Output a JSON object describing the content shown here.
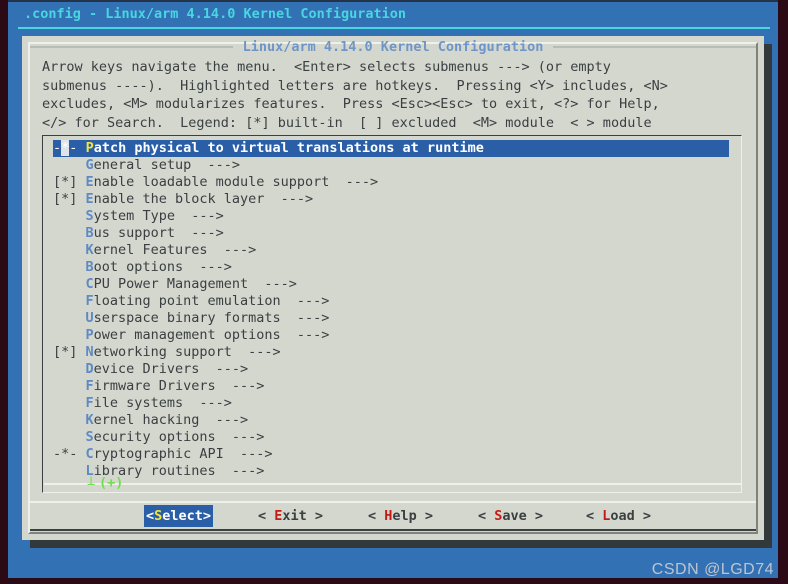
{
  "window": {
    "title": ".config - Linux/arm 4.14.0 Kernel Configuration"
  },
  "dialog": {
    "title": "Linux/arm 4.14.0 Kernel Configuration",
    "help_lines": [
      "Arrow keys navigate the menu.  <Enter> selects submenus ---> (or empty",
      "submenus ----).  Highlighted letters are hotkeys.  Pressing <Y> includes, <N>",
      "excludes, <M> modularizes features.  Press <Esc><Esc> to exit, <?> for Help,",
      "</> for Search.  Legend: [*] built-in  [ ] excluded  <M> module  < > module"
    ]
  },
  "menu": {
    "scroll_indicator": "(+)",
    "items": [
      {
        "marker": "-*-",
        "hotkey": "P",
        "label": "atch physical to virtual translations at runtime",
        "arrow": "",
        "selected": true
      },
      {
        "marker": "   ",
        "hotkey": "G",
        "label": "eneral setup",
        "arrow": "  --->",
        "selected": false
      },
      {
        "marker": "[*]",
        "hotkey": "E",
        "label": "nable loadable module support",
        "arrow": "  --->",
        "selected": false
      },
      {
        "marker": "[*]",
        "hotkey": "E",
        "label": "nable the block layer",
        "arrow": "  --->",
        "selected": false
      },
      {
        "marker": "   ",
        "hotkey": "S",
        "label": "ystem Type",
        "arrow": "  --->",
        "selected": false
      },
      {
        "marker": "   ",
        "hotkey": "B",
        "label": "us support",
        "arrow": "  --->",
        "selected": false
      },
      {
        "marker": "   ",
        "hotkey": "K",
        "label": "ernel Features",
        "arrow": "  --->",
        "selected": false
      },
      {
        "marker": "   ",
        "hotkey": "B",
        "label": "oot options",
        "arrow": "  --->",
        "selected": false
      },
      {
        "marker": "   ",
        "hotkey": "C",
        "label": "PU Power Management",
        "arrow": "  --->",
        "selected": false
      },
      {
        "marker": "   ",
        "hotkey": "F",
        "label": "loating point emulation",
        "arrow": "  --->",
        "selected": false
      },
      {
        "marker": "   ",
        "hotkey": "U",
        "label": "serspace binary formats",
        "arrow": "  --->",
        "selected": false
      },
      {
        "marker": "   ",
        "hotkey": "P",
        "label": "ower management options",
        "arrow": "  --->",
        "selected": false
      },
      {
        "marker": "[*]",
        "hotkey": "N",
        "label": "etworking support",
        "arrow": "  --->",
        "selected": false
      },
      {
        "marker": "   ",
        "hotkey": "D",
        "label": "evice Drivers",
        "arrow": "  --->",
        "selected": false
      },
      {
        "marker": "   ",
        "hotkey": "F",
        "label": "irmware Drivers",
        "arrow": "  --->",
        "selected": false
      },
      {
        "marker": "   ",
        "hotkey": "F",
        "label": "ile systems",
        "arrow": "  --->",
        "selected": false
      },
      {
        "marker": "   ",
        "hotkey": "K",
        "label": "ernel hacking",
        "arrow": "  --->",
        "selected": false
      },
      {
        "marker": "   ",
        "hotkey": "S",
        "label": "ecurity options",
        "arrow": "  --->",
        "selected": false
      },
      {
        "marker": "-*-",
        "hotkey": "C",
        "label": "ryptographic API",
        "arrow": "  --->",
        "selected": false
      },
      {
        "marker": "   ",
        "hotkey": "L",
        "label": "ibrary routines",
        "arrow": "  --->",
        "selected": false
      }
    ]
  },
  "buttons": [
    {
      "prefix": "<",
      "hotkey": "S",
      "rest": "elect",
      "suffix": ">",
      "active": true
    },
    {
      "prefix": "< ",
      "hotkey": "E",
      "rest": "xit",
      "suffix": " >",
      "active": false
    },
    {
      "prefix": "< ",
      "hotkey": "H",
      "rest": "elp",
      "suffix": " >",
      "active": false
    },
    {
      "prefix": "< ",
      "hotkey": "S",
      "rest": "ave",
      "suffix": " >",
      "active": false
    },
    {
      "prefix": "< ",
      "hotkey": "L",
      "rest": "oad",
      "suffix": " >",
      "active": false
    }
  ],
  "watermark": "CSDN @LGD74",
  "colors": {
    "terminal_bg": "#3272b4",
    "chrome": "#2b0a16",
    "dialog_bg": "#d4d7ce",
    "title_cyan": "#49d6e0",
    "dialog_title_blue": "#6f95c7",
    "hotkey_blue": "#5d89c4",
    "selection_blue": "#2a5fa8",
    "selection_hotkey_yellow": "#f2e53c",
    "button_hotkey_red": "#c31c16",
    "scroll_green": "#6fe04a",
    "text": "#3a3f42"
  }
}
